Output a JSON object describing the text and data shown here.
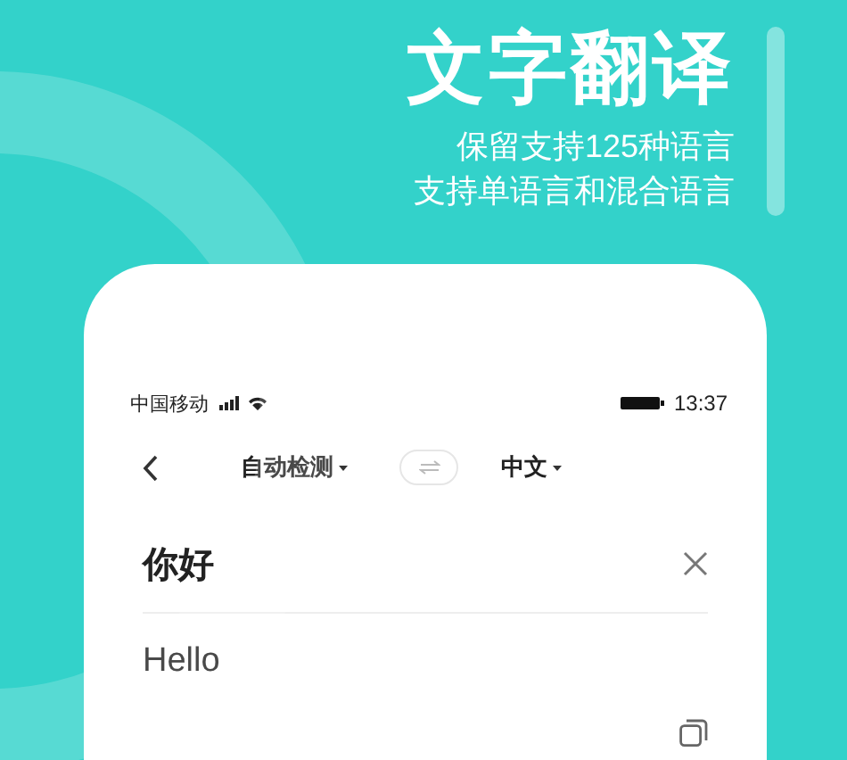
{
  "promo": {
    "title": "文字翻译",
    "subtitle_lines": [
      "保留支持125种语言",
      "支持单语言和混合语言"
    ]
  },
  "status_bar": {
    "carrier": "中国移动",
    "time": "13:37"
  },
  "translate_bar": {
    "source_language": "自动检测",
    "target_language": "中文"
  },
  "input": {
    "value": "你好"
  },
  "output": {
    "text": "Hello"
  }
}
